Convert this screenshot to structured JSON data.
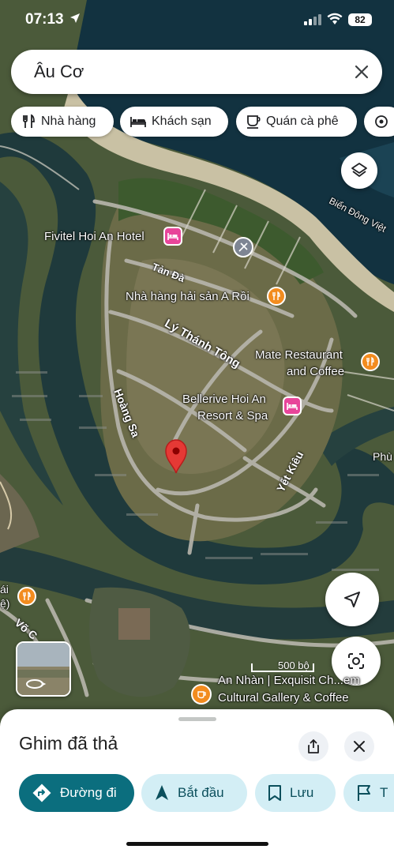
{
  "status_bar": {
    "time": "07:13",
    "battery": "82"
  },
  "search": {
    "query": "Âu Cơ"
  },
  "chips": [
    {
      "label": "Nhà hàng",
      "icon": "fork-knife-icon"
    },
    {
      "label": "Khách sạn",
      "icon": "bed-icon"
    },
    {
      "label": "Quán cà phê",
      "icon": "coffee-cup-icon"
    }
  ],
  "map": {
    "places": {
      "fivitel": "Fivitel Hoi An Hotel",
      "nha_hang": "Nhà hàng hải sản A Rồi",
      "mate_1": "Mate Restaurant",
      "mate_2": "and Coffee",
      "bellerive_1": "Bellerive Hoi An",
      "bellerive_2": "Resort & Spa",
      "an_nhan_1": "An Nhàn | Exquisit Ch...em",
      "an_nhan_2": "Cultural Gallery & Coffee",
      "bien_dong": "Biển Đông Việt",
      "phu": "Phù"
    },
    "streets": {
      "tan_da": "Tản Đà",
      "ly_thanh_tong": "Lý Thánh Tông",
      "hoang_sa": "Hoàng Sa",
      "yet_kieu": "Yết Kiêu",
      "vo_chi": "Võ C"
    },
    "edge_label": "ái\nệ)",
    "scale": "500 bộ"
  },
  "sheet": {
    "title": "Ghim đã thả",
    "actions": [
      {
        "label": "Đường đi",
        "icon": "directions-icon"
      },
      {
        "label": "Bắt đầu",
        "icon": "navigation-arrow-icon"
      },
      {
        "label": "Lưu",
        "icon": "bookmark-icon"
      },
      {
        "label": "T",
        "icon": "flag-icon"
      }
    ]
  }
}
